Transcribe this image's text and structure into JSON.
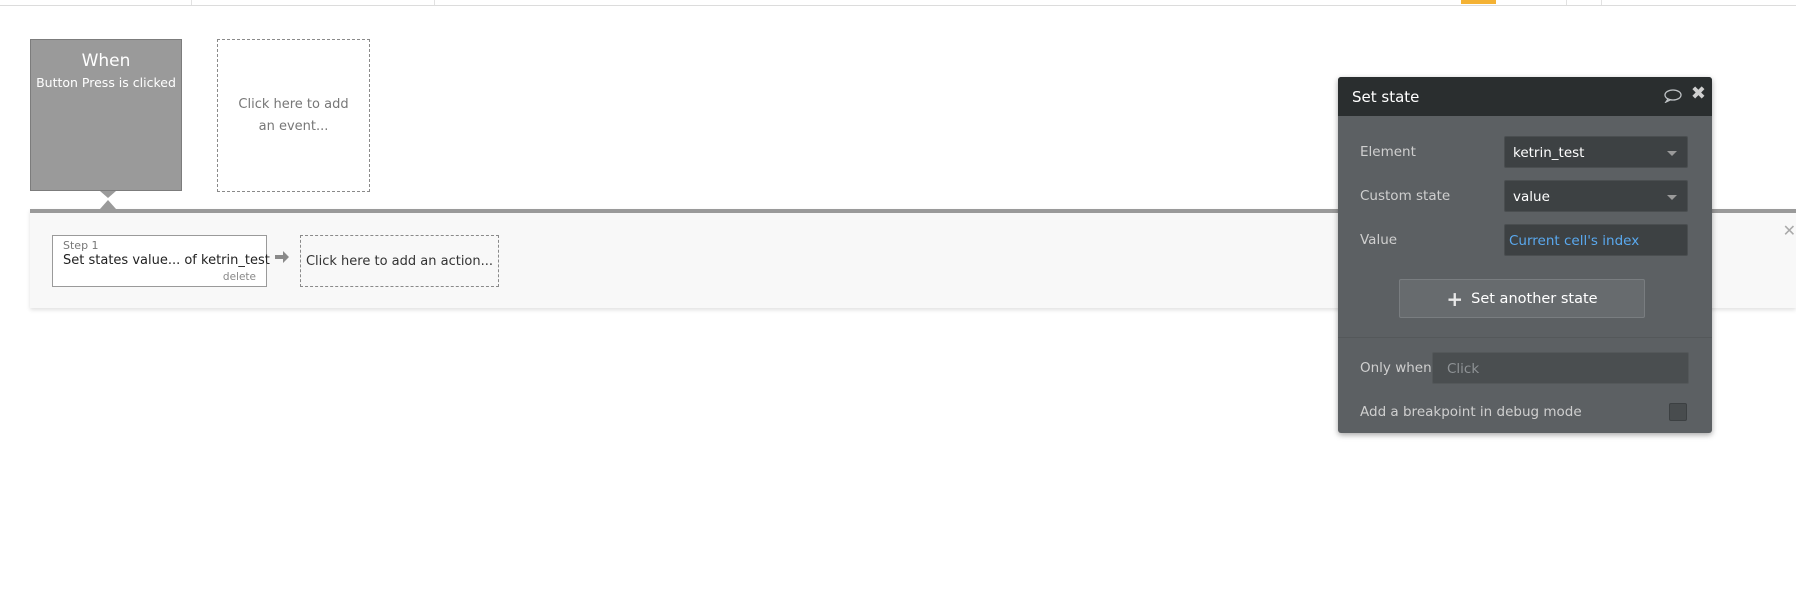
{
  "event": {
    "when_label": "When",
    "description": "Button Press is clicked",
    "add_event_text": "Click here to add an event..."
  },
  "actions": {
    "step_number": "Step 1",
    "step_title": "Set states value... of ketrin_test",
    "delete_label": "delete",
    "add_action_text": "Click here to add an action..."
  },
  "panel": {
    "title": "Set state",
    "element_label": "Element",
    "element_value": "ketrin_test",
    "custom_state_label": "Custom state",
    "custom_state_value": "value",
    "value_label": "Value",
    "value_expression": "Current cell's index",
    "add_state_button": "Set another state",
    "only_when_label": "Only when",
    "only_when_placeholder": "Click",
    "breakpoint_label": "Add a breakpoint in debug mode",
    "breakpoint_checked": false
  },
  "icons": {
    "comment": "comment-icon",
    "close": "close-icon",
    "plus": "plus-icon",
    "arrow": "arrow-right-icon",
    "caret": "caret-down-icon"
  },
  "colors": {
    "accent": "#f4b234",
    "link_blue": "#5aa9ef",
    "panel_bg": "#5c6063",
    "panel_header": "#2a2e2f",
    "event_card": "#9a9a9a"
  }
}
